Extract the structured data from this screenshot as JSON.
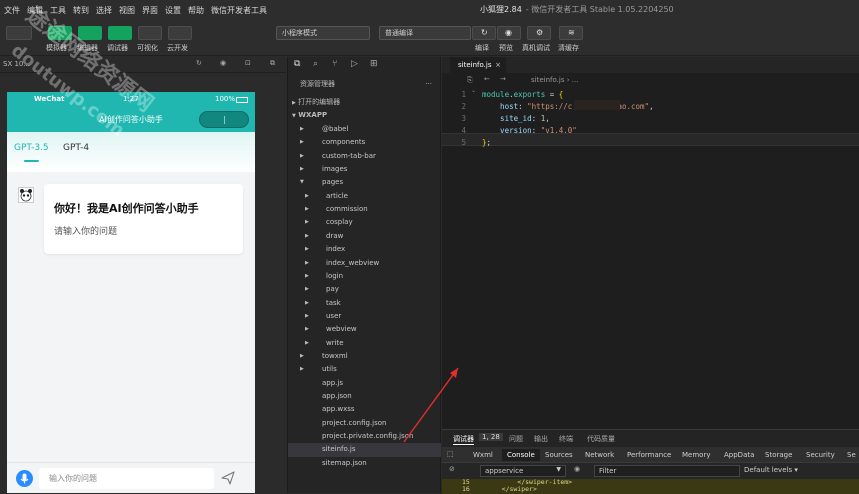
{
  "menu": [
    "文件",
    "编辑",
    "工具",
    "转到",
    "选择",
    "视图",
    "界面",
    "设置",
    "帮助",
    "微信开发者工具"
  ],
  "window": {
    "title": "小狐狸2.84",
    "subtitle": "- 微信开发者工具 Stable 1.05.2204250"
  },
  "toolbar": {
    "left_buttons": [
      "模拟器",
      "编辑器",
      "调试器",
      "可视化",
      "云开发"
    ],
    "mode_select": "小程序模式",
    "compile_select": "普通编译",
    "right_buttons": [
      "编译",
      "预览",
      "真机调试",
      "清缓存"
    ]
  },
  "simulator": {
    "device_label": "SX 10...",
    "phone": {
      "status_left": "WeChat",
      "status_time": "1:27",
      "status_battery": "100%",
      "nav_title": "AI创作问答小助手",
      "tabs": [
        "GPT-3.5",
        "GPT-4"
      ],
      "greeting_title": "你好！我是AI创作问答小助手",
      "greeting_sub": "请输入你的问题",
      "input_placeholder": "输入你的问题"
    }
  },
  "explorer": {
    "header": "资源管理器",
    "header_more": "···",
    "open_editors": "打开的编辑器",
    "project": "WXAPP",
    "tree": [
      {
        "label": "@babel",
        "depth": 1,
        "folder": true
      },
      {
        "label": "components",
        "depth": 1,
        "folder": true
      },
      {
        "label": "custom-tab-bar",
        "depth": 1,
        "folder": true
      },
      {
        "label": "images",
        "depth": 1,
        "folder": true
      },
      {
        "label": "pages",
        "depth": 1,
        "folder": true,
        "open": true
      },
      {
        "label": "article",
        "depth": 2,
        "folder": true
      },
      {
        "label": "commission",
        "depth": 2,
        "folder": true
      },
      {
        "label": "cosplay",
        "depth": 2,
        "folder": true
      },
      {
        "label": "draw",
        "depth": 2,
        "folder": true
      },
      {
        "label": "index",
        "depth": 2,
        "folder": true
      },
      {
        "label": "index_webview",
        "depth": 2,
        "folder": true
      },
      {
        "label": "login",
        "depth": 2,
        "folder": true
      },
      {
        "label": "pay",
        "depth": 2,
        "folder": true
      },
      {
        "label": "task",
        "depth": 2,
        "folder": true
      },
      {
        "label": "user",
        "depth": 2,
        "folder": true
      },
      {
        "label": "webview",
        "depth": 2,
        "folder": true
      },
      {
        "label": "write",
        "depth": 2,
        "folder": true
      },
      {
        "label": "towxml",
        "depth": 1,
        "folder": true
      },
      {
        "label": "utils",
        "depth": 1,
        "folder": true
      },
      {
        "label": "app.js",
        "depth": 1,
        "folder": false
      },
      {
        "label": "app.json",
        "depth": 1,
        "folder": false
      },
      {
        "label": "app.wxss",
        "depth": 1,
        "folder": false
      },
      {
        "label": "project.config.json",
        "depth": 1,
        "folder": false
      },
      {
        "label": "project.private.config.json",
        "depth": 1,
        "folder": false
      },
      {
        "label": "siteinfo.js",
        "depth": 1,
        "folder": false,
        "selected": true
      },
      {
        "label": "sitemap.json",
        "depth": 1,
        "folder": false
      }
    ]
  },
  "editor": {
    "tab": "siteinfo.js",
    "tab_close": "×",
    "breadcrumb": "siteinfo.js › ...",
    "lines": [
      {
        "n": "1",
        "tokens": [
          [
            "kw",
            "module"
          ],
          [
            "plain",
            "."
          ],
          [
            "kw",
            "exports"
          ],
          [
            "plain",
            " = "
          ],
          [
            "brk",
            "{"
          ]
        ]
      },
      {
        "n": "2",
        "tokens": [
          [
            "prop",
            "    host"
          ],
          [
            "plain",
            ": "
          ],
          [
            "str",
            "\"https://c         hao.com\""
          ],
          [
            "plain",
            ","
          ]
        ]
      },
      {
        "n": "3",
        "tokens": [
          [
            "prop",
            "    site_id"
          ],
          [
            "plain",
            ": "
          ],
          [
            "num",
            "1"
          ],
          [
            "plain",
            ","
          ]
        ]
      },
      {
        "n": "4",
        "tokens": [
          [
            "prop",
            "    version"
          ],
          [
            "plain",
            ": "
          ],
          [
            "str",
            "\"v1.4.0\""
          ]
        ]
      },
      {
        "n": "5",
        "tokens": [
          [
            "brk",
            "}"
          ],
          [
            "plain",
            ";"
          ]
        ]
      }
    ]
  },
  "debugger": {
    "tabs": [
      "调试器",
      "1, 28",
      "问题",
      "输出",
      "终端",
      "代码质量"
    ],
    "devtools_tabs": [
      "Wxml",
      "Console",
      "Sources",
      "Network",
      "Performance",
      "Memory",
      "AppData",
      "Storage",
      "Security",
      "Se"
    ],
    "active_devtab": "Console",
    "context": "appservice",
    "filter_placeholder": "Filter",
    "levels": "Default levels ▾",
    "code_lines": [
      {
        "n": "15",
        "text": "        </swiper-item>"
      },
      {
        "n": "16",
        "text": "    </swiper>"
      }
    ]
  },
  "watermark": {
    "line1": "途途网络资源网",
    "line2": "doutuwp.com"
  },
  "colors": {
    "accent_teal": "#1fb7b0",
    "green_button": "#13a35e",
    "editor_bg": "#1e1e1e",
    "annotation_arrow": "#e0302c"
  }
}
